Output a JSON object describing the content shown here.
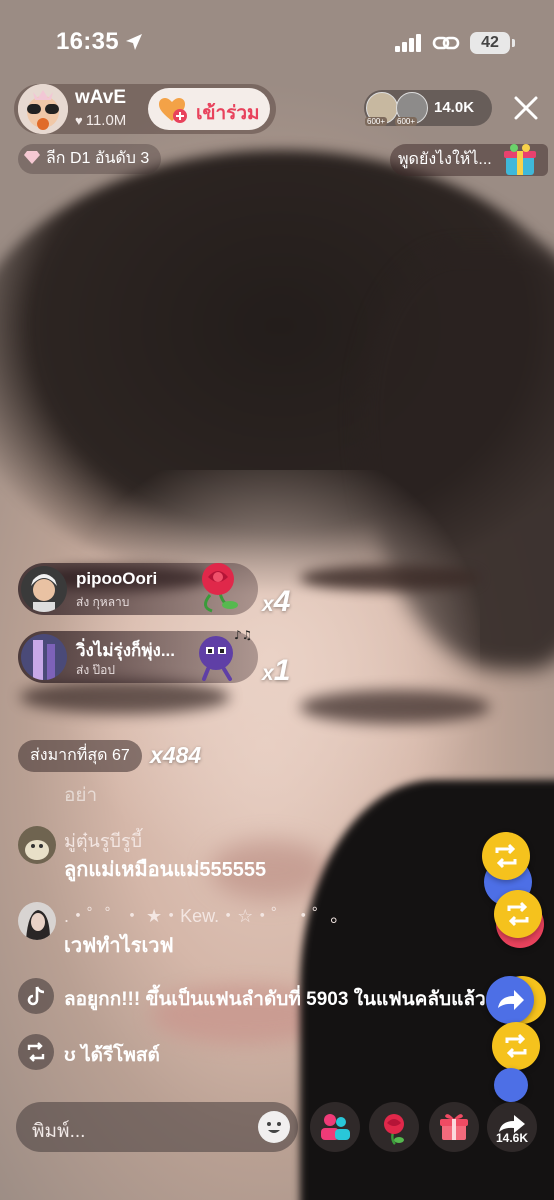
{
  "status_bar": {
    "time": "16:35",
    "battery": "42"
  },
  "host": {
    "name": "wAvE",
    "likes": "11.0M",
    "join_label": "เข้าร่วม"
  },
  "viewers": {
    "count": "14.0K",
    "badge_1": "600+",
    "badge_2": "600+"
  },
  "league": {
    "label": "ลีก D1 อันดับ 3"
  },
  "promo": {
    "text": "พูดยังไงให้ไ..."
  },
  "gifts": [
    {
      "user": "pipooOori",
      "action": "ส่ง กุหลาบ",
      "multiplier": "4"
    },
    {
      "user": "วิ่งไม่รุ่งก็พุ่ง...",
      "action": "ส่ง ป๊อป",
      "multiplier": "1"
    }
  ],
  "top_gifter": {
    "label": "ส่งมากที่สุด 67",
    "multiplier": "484"
  },
  "chat": {
    "faded": "อย่า",
    "messages": [
      {
        "name": "มู่ตุ๋นรูบีรูบี้",
        "text": "ลูกแม่เหมือนแม่555555"
      },
      {
        "name": ".・゜゜・ ★・Kew.・☆・゜ ・゜。",
        "text": "เวฟทำไรเวฟ"
      }
    ],
    "system": [
      {
        "text": "ลอยูกก!!! ขึ้นเป็นแฟนลำดับที่ 5903 ในแฟนคลับแล้ว"
      },
      {
        "text": "ʊ ได้รีโพสต์"
      }
    ]
  },
  "bottom_bar": {
    "placeholder": "พิมพ์...",
    "share_count": "14.6K"
  },
  "colors": {
    "accent": "#e8425c",
    "float_yellow": "#f5c21d",
    "float_blue": "#4d6fe6"
  }
}
